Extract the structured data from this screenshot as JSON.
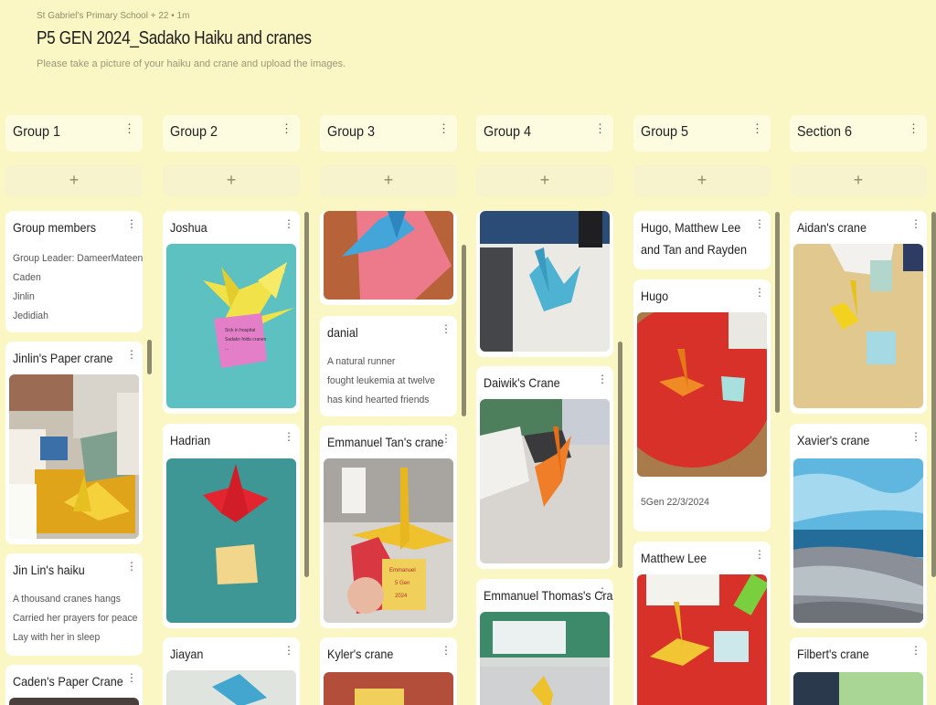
{
  "header": {
    "meta": "St Gabriel's Primary School + 22 • 1m",
    "title": "P5 GEN 2024_Sadako Haiku and cranes",
    "description": "Please take a picture of your haiku and crane and upload the images."
  },
  "add_label": "+",
  "menu_glyph": "⋮",
  "columns": [
    {
      "title": "Group 1",
      "cards": [
        {
          "title": "Group members",
          "lines": [
            "Group Leader: DameerMateen",
            "Caden",
            "Jinlin",
            "Jedidiah"
          ]
        },
        {
          "title": "Jinlin's Paper crane",
          "image": "photo of a yellow paper crane beside a haiku note"
        },
        {
          "title": "Jin Lin's haiku",
          "lines": [
            "A thousand cranes hangs",
            "Carried her prayers for peace",
            "Lay with her in sleep"
          ]
        },
        {
          "title": "Caden's Paper Crane"
        }
      ]
    },
    {
      "title": "Group 2",
      "cards": [
        {
          "title": "Joshua",
          "image": "yellow paper crane with a pink haiku note on blue paper",
          "note_text": "Sick in hospital / Sadako folds cranes / ..."
        },
        {
          "title": "Hadrian",
          "image": "red paper crane with a yellow haiku note on teal paper"
        },
        {
          "title": "Jiayan"
        }
      ]
    },
    {
      "title": "Group  3",
      "cards": [
        {
          "title": "",
          "image": "blue paper crane on a pink note"
        },
        {
          "title": "danial",
          "lines": [
            "A natural runner",
            "fought leukemia at twelve",
            "has kind hearted friends"
          ]
        },
        {
          "title": "Emmanuel Tan's crane",
          "image": "yellow paper crane held up in a classroom",
          "note_lines": [
            "Emmanuel",
            "5 Gen",
            "2024"
          ]
        },
        {
          "title": "Kyler's crane"
        }
      ]
    },
    {
      "title": "Group 4",
      "cards": [
        {
          "title": "",
          "image": "blue paper crane on a classroom table"
        },
        {
          "title": "Daiwik's Crane",
          "image": "orange paper crane on a table"
        },
        {
          "title": "Emmanuel Thomas's Crane",
          "image": "paper crane in a classroom"
        }
      ]
    },
    {
      "title": "Group  5",
      "cards": [
        {
          "title": "Hugo, Matthew Lee and Tan and Rayden"
        },
        {
          "title": "Hugo",
          "image": "orange paper crane on a red circle",
          "caption": "5Gen 22/3/2024"
        },
        {
          "title": "Matthew Lee",
          "image": "yellow paper crane on a red circle with a haiku book"
        }
      ]
    },
    {
      "title": "Section 6",
      "cards": [
        {
          "title": "Aidan's crane",
          "image": "yellow paper crane with a blue note"
        },
        {
          "title": "Xavier's crane",
          "image": "painting of a seascape"
        },
        {
          "title": "Filbert's crane",
          "image": "green paper and book"
        }
      ]
    }
  ],
  "colors": {
    "background": "#fbf7c4",
    "card": "#ffffff",
    "column_header": "#fdfbe0",
    "scrollbar": "#8d8a6e"
  },
  "icons": {
    "add": "plus-icon",
    "menu": "kebab-menu-icon"
  }
}
